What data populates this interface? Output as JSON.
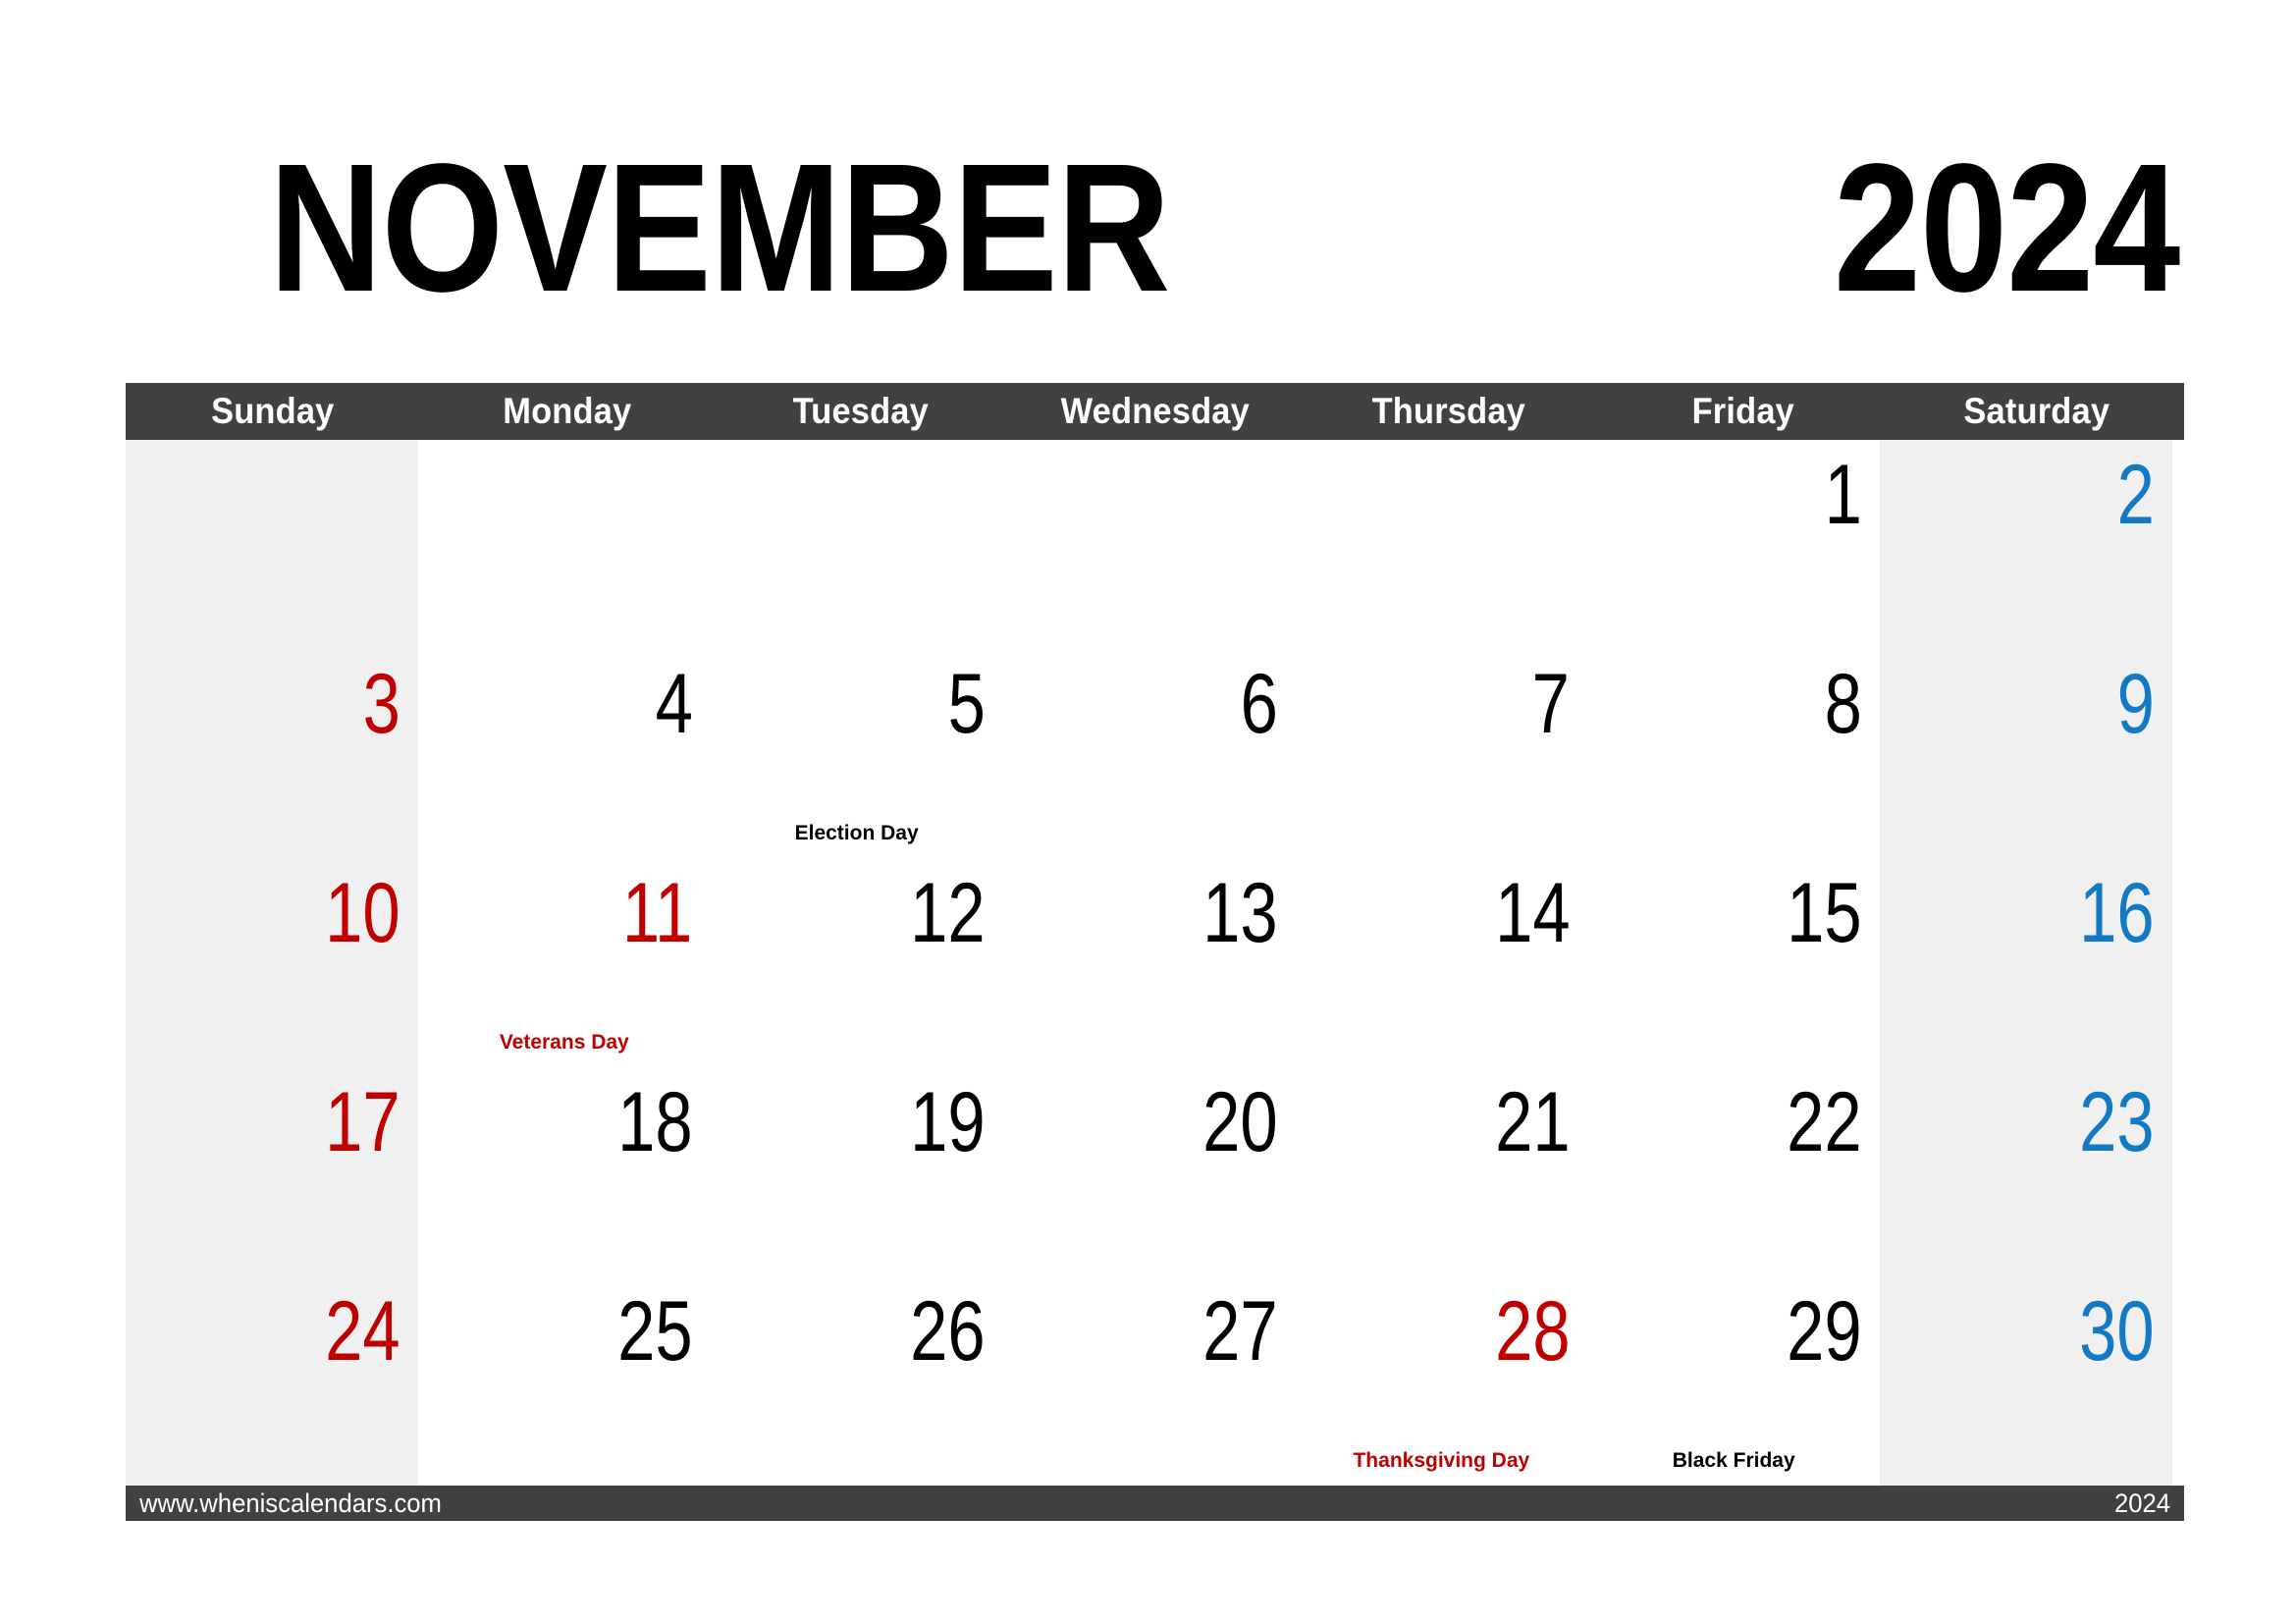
{
  "title": {
    "month": "NOVEMBER",
    "year": "2024"
  },
  "colors": {
    "header_bar": "#414141",
    "weekend_bg": "#f0f0f0",
    "sunday_text": "#c00000",
    "saturday_text": "#1479c4",
    "weekday_text": "#000000",
    "holiday_text": "#c00000",
    "page_bg": "#ffffff"
  },
  "weekdays": [
    "Sunday",
    "Monday",
    "Tuesday",
    "Wednesday",
    "Thursday",
    "Friday",
    "Saturday"
  ],
  "weeks": [
    [
      {
        "date": "",
        "color": "black",
        "holiday": "",
        "holiday_color": "black"
      },
      {
        "date": "",
        "color": "black",
        "holiday": "",
        "holiday_color": "black"
      },
      {
        "date": "",
        "color": "black",
        "holiday": "",
        "holiday_color": "black"
      },
      {
        "date": "",
        "color": "black",
        "holiday": "",
        "holiday_color": "black"
      },
      {
        "date": "",
        "color": "black",
        "holiday": "",
        "holiday_color": "black"
      },
      {
        "date": "1",
        "color": "black",
        "holiday": "",
        "holiday_color": "black"
      },
      {
        "date": "2",
        "color": "blue",
        "holiday": "",
        "holiday_color": "black"
      }
    ],
    [
      {
        "date": "3",
        "color": "red",
        "holiday": "",
        "holiday_color": "black"
      },
      {
        "date": "4",
        "color": "black",
        "holiday": "",
        "holiday_color": "black"
      },
      {
        "date": "5",
        "color": "black",
        "holiday": "Election Day",
        "holiday_color": "black"
      },
      {
        "date": "6",
        "color": "black",
        "holiday": "",
        "holiday_color": "black"
      },
      {
        "date": "7",
        "color": "black",
        "holiday": "",
        "holiday_color": "black"
      },
      {
        "date": "8",
        "color": "black",
        "holiday": "",
        "holiday_color": "black"
      },
      {
        "date": "9",
        "color": "blue",
        "holiday": "",
        "holiday_color": "black"
      }
    ],
    [
      {
        "date": "10",
        "color": "red",
        "holiday": "",
        "holiday_color": "black"
      },
      {
        "date": "11",
        "color": "red",
        "holiday": "Veterans Day",
        "holiday_color": "red"
      },
      {
        "date": "12",
        "color": "black",
        "holiday": "",
        "holiday_color": "black"
      },
      {
        "date": "13",
        "color": "black",
        "holiday": "",
        "holiday_color": "black"
      },
      {
        "date": "14",
        "color": "black",
        "holiday": "",
        "holiday_color": "black"
      },
      {
        "date": "15",
        "color": "black",
        "holiday": "",
        "holiday_color": "black"
      },
      {
        "date": "16",
        "color": "blue",
        "holiday": "",
        "holiday_color": "black"
      }
    ],
    [
      {
        "date": "17",
        "color": "red",
        "holiday": "",
        "holiday_color": "black"
      },
      {
        "date": "18",
        "color": "black",
        "holiday": "",
        "holiday_color": "black"
      },
      {
        "date": "19",
        "color": "black",
        "holiday": "",
        "holiday_color": "black"
      },
      {
        "date": "20",
        "color": "black",
        "holiday": "",
        "holiday_color": "black"
      },
      {
        "date": "21",
        "color": "black",
        "holiday": "",
        "holiday_color": "black"
      },
      {
        "date": "22",
        "color": "black",
        "holiday": "",
        "holiday_color": "black"
      },
      {
        "date": "23",
        "color": "blue",
        "holiday": "",
        "holiday_color": "black"
      }
    ],
    [
      {
        "date": "24",
        "color": "red",
        "holiday": "",
        "holiday_color": "black"
      },
      {
        "date": "25",
        "color": "black",
        "holiday": "",
        "holiday_color": "black"
      },
      {
        "date": "26",
        "color": "black",
        "holiday": "",
        "holiday_color": "black"
      },
      {
        "date": "27",
        "color": "black",
        "holiday": "",
        "holiday_color": "black"
      },
      {
        "date": "28",
        "color": "red",
        "holiday": "Thanksgiving Day",
        "holiday_color": "red"
      },
      {
        "date": "29",
        "color": "black",
        "holiday": "Black Friday",
        "holiday_color": "black"
      },
      {
        "date": "30",
        "color": "blue",
        "holiday": "",
        "holiday_color": "black"
      }
    ]
  ],
  "footer": {
    "url": "www.wheniscalendars.com",
    "year": "2024"
  }
}
